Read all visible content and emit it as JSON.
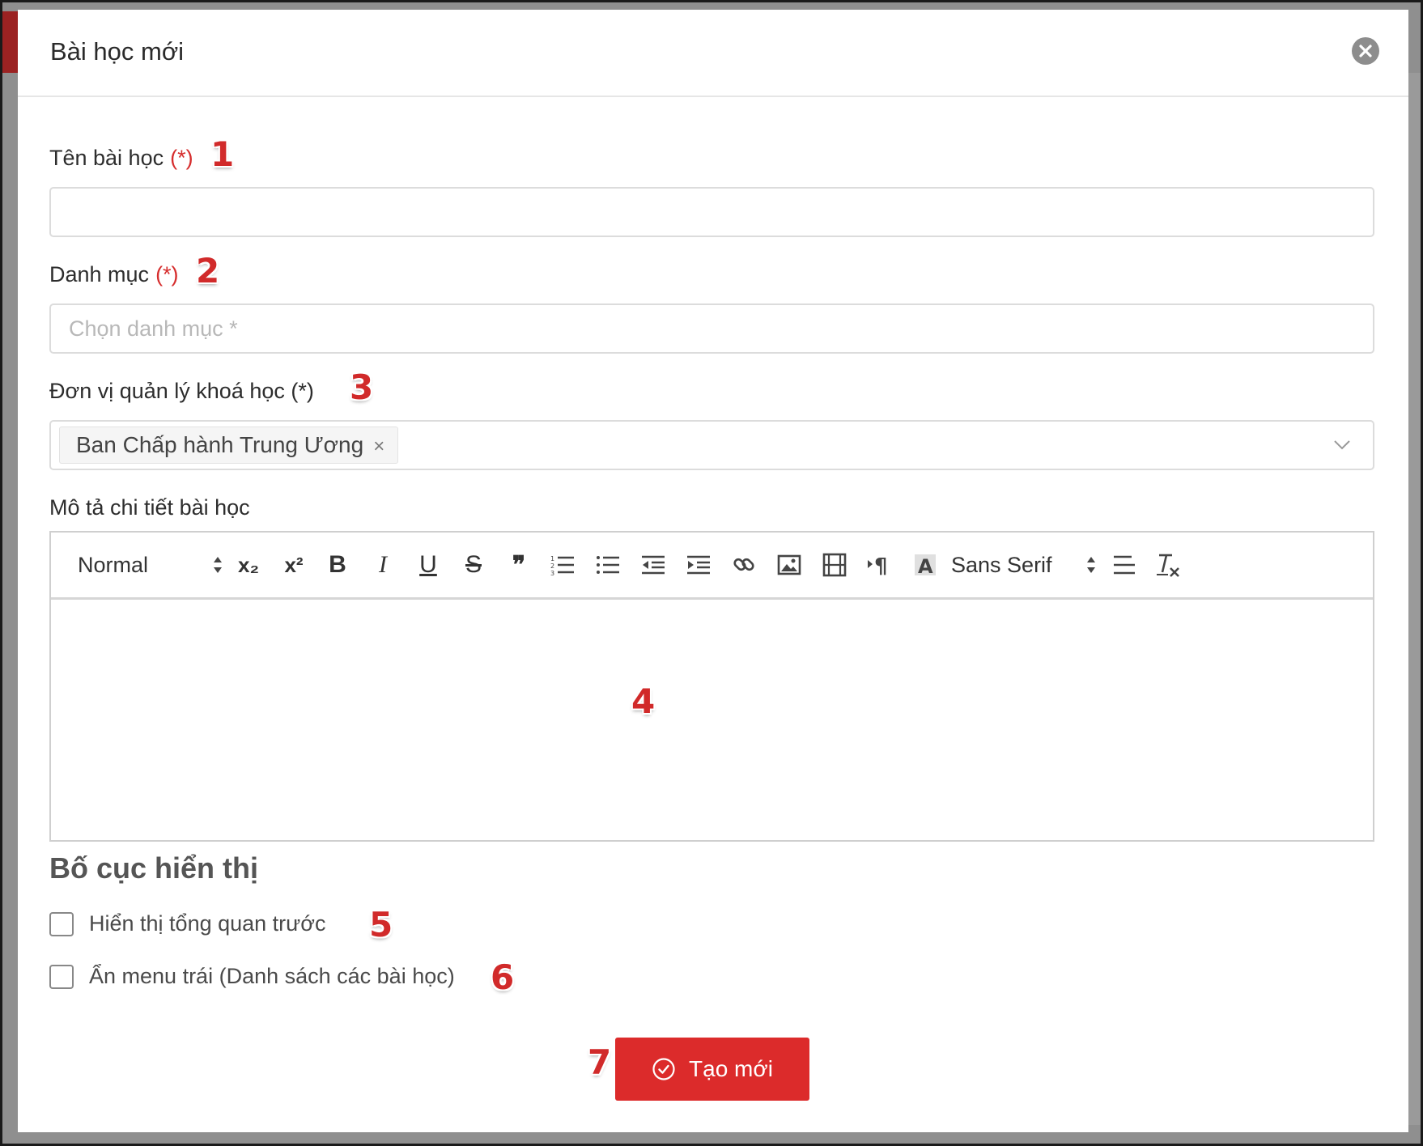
{
  "modal": {
    "title": "Bài học mới"
  },
  "form": {
    "lesson_name": {
      "label": "Tên bài học",
      "required_mark": "(*)",
      "value": "",
      "step": "1"
    },
    "category": {
      "label": "Danh mục",
      "required_mark": "(*)",
      "placeholder": "Chọn danh mục *",
      "step": "2"
    },
    "managing_unit": {
      "label": "Đơn vị quản lý khoá học (*)",
      "selected_tag": "Ban Chấp hành Trung Ương",
      "tag_remove": "×",
      "step": "3"
    },
    "description": {
      "label": "Mô tả chi tiết bài học",
      "step": "4",
      "toolbar": {
        "header_select": "Normal",
        "font_select": "Sans Serif",
        "subscript": "x₂",
        "superscript": "x²",
        "bold": "B",
        "italic": "I",
        "underline": "U",
        "strike": "S",
        "blockquote": "❞"
      }
    }
  },
  "layout_section": {
    "title": "Bố cục hiển thị",
    "show_overview": {
      "label": "Hiển thị tổng quan trước",
      "checked": false,
      "step": "5"
    },
    "hide_left_menu": {
      "label": "Ẩn menu trái (Danh sách các bài học)",
      "checked": false,
      "step": "6"
    }
  },
  "submit": {
    "label": "Tạo mới",
    "step": "7"
  },
  "colors": {
    "accent_red": "#dc2b2b",
    "annotation_red": "#d12a2a"
  }
}
